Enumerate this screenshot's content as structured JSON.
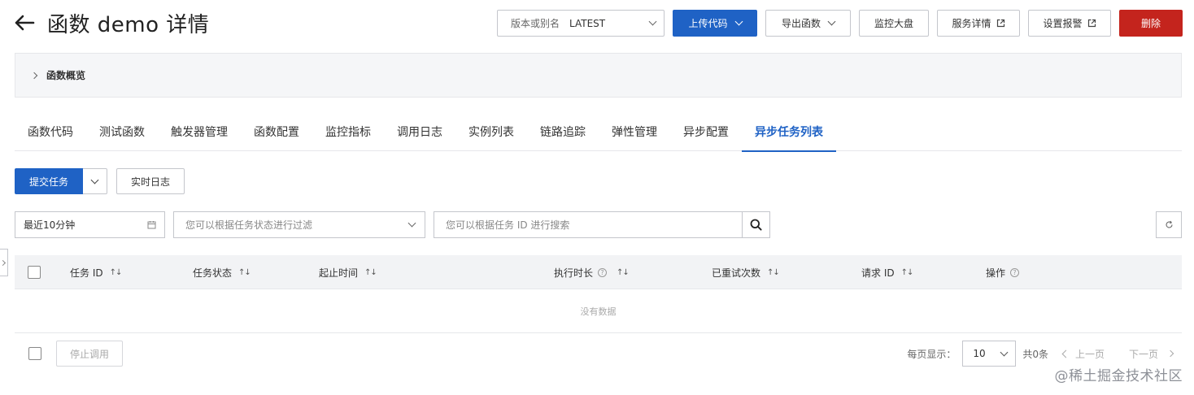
{
  "header": {
    "title": "函数 demo 详情"
  },
  "toolbar": {
    "version_label": "版本或别名",
    "version_value": "LATEST",
    "upload_code": "上传代码",
    "export_function": "导出函数",
    "monitor_dashboard": "监控大盘",
    "service_details": "服务详情",
    "set_alarm": "设置报警",
    "delete": "删除"
  },
  "overview": {
    "label": "函数概览"
  },
  "tabs": [
    {
      "label": "函数代码"
    },
    {
      "label": "测试函数"
    },
    {
      "label": "触发器管理"
    },
    {
      "label": "函数配置"
    },
    {
      "label": "监控指标"
    },
    {
      "label": "调用日志"
    },
    {
      "label": "实例列表"
    },
    {
      "label": "链路追踪"
    },
    {
      "label": "弹性管理"
    },
    {
      "label": "异步配置"
    },
    {
      "label": "异步任务列表",
      "active": true
    }
  ],
  "actions": {
    "submit_task": "提交任务",
    "realtime_log": "实时日志"
  },
  "filters": {
    "time_range": "最近10分钟",
    "status_placeholder": "您可以根据任务状态进行过滤",
    "search_placeholder": "您可以根据任务 ID 进行搜索"
  },
  "table": {
    "columns": [
      "任务 ID",
      "任务状态",
      "起止时间",
      "执行时长",
      "已重试次数",
      "请求 ID",
      "操作"
    ],
    "empty_text": "没有数据"
  },
  "footer": {
    "stop_invoke": "停止调用",
    "page_size_label": "每页显示：",
    "page_size": "10",
    "total": "共0条",
    "prev": "上一页",
    "next": "下一页"
  },
  "watermark": "@稀土掘金技术社区",
  "colors": {
    "primary": "#1f62c5",
    "danger": "#c4241d"
  }
}
